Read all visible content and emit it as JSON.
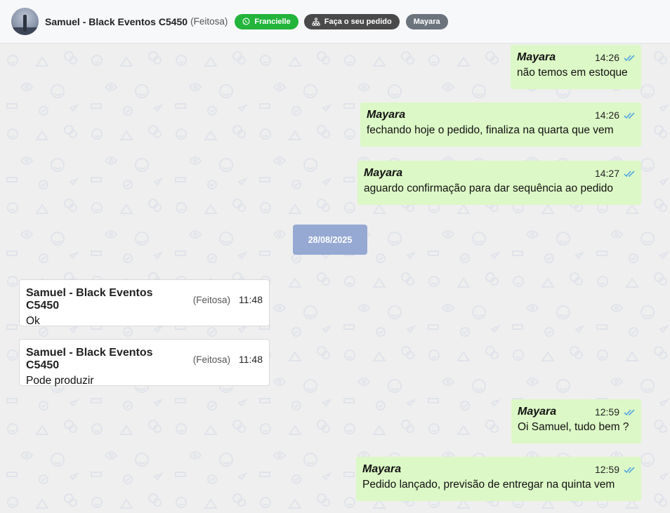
{
  "header": {
    "contact_name": "Samuel - Black Eventos C5450",
    "contact_tag": "(Feitosa)",
    "badges": [
      {
        "label": "Francielle",
        "icon": "whatsapp-icon",
        "color": "#22b43b"
      },
      {
        "label": "Faça o seu pedido",
        "icon": "flow-icon",
        "color": "#4a4a4a"
      },
      {
        "label": "Mayara",
        "color": "#6b747d"
      }
    ]
  },
  "date_divider": "28/08/2025",
  "messages": [
    {
      "direction": "out",
      "sender": "Mayara",
      "time": "14:26",
      "text": "não temos em estoque",
      "status": "read"
    },
    {
      "direction": "out",
      "sender": "Mayara",
      "time": "14:26",
      "text": "fechando hoje o pedido, finaliza na quarta que vem",
      "status": "read"
    },
    {
      "direction": "out",
      "sender": "Mayara",
      "time": "14:27",
      "text": "aguardo confirmação para dar sequência ao pedido",
      "status": "read"
    },
    {
      "direction": "in",
      "sender": "Samuel - Black Eventos C5450",
      "sender_tag": "(Feitosa)",
      "time": "11:48",
      "text": "Ok"
    },
    {
      "direction": "in",
      "sender": "Samuel - Black Eventos C5450",
      "sender_tag": "(Feitosa)",
      "time": "11:48",
      "text": "Pode produzir"
    },
    {
      "direction": "out",
      "sender": "Mayara",
      "time": "12:59",
      "text": "Oi Samuel, tudo bem ?",
      "status": "read"
    },
    {
      "direction": "out",
      "sender": "Mayara",
      "time": "12:59",
      "text": "Pedido lançado, previsão de entregar na quinta vem",
      "status": "read"
    }
  ],
  "colors": {
    "outgoing_bubble": "#dcf8c6",
    "incoming_bubble": "#ffffff",
    "read_ticks": "#53a6e0",
    "date_divider": "#95a9d3",
    "chat_background": "#efefef"
  }
}
